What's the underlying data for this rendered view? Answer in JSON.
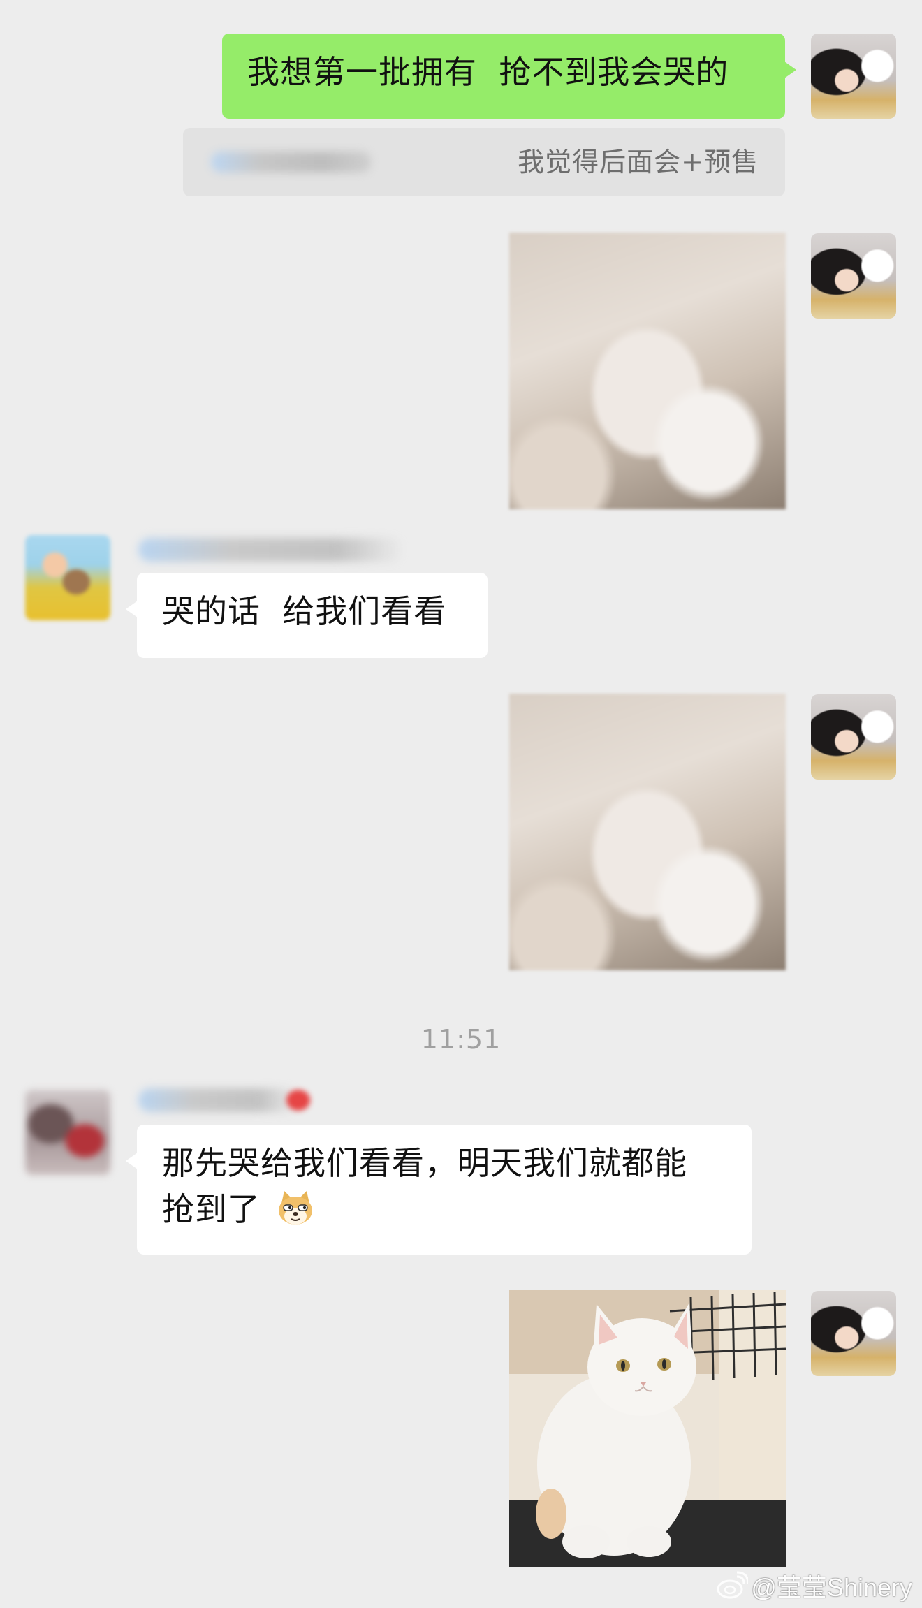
{
  "messages": {
    "m1": {
      "text": "我想第一批拥有  抢不到我会哭的",
      "quote_text": "我觉得后面会+预售"
    },
    "m3": {
      "text": "哭的话  给我们看看"
    },
    "m5": {
      "text_line1": "那先哭给我们看看，明天我们就都能",
      "text_line2": "抢到了"
    }
  },
  "timestamp": "11:51",
  "watermark": "@莹莹Shinery",
  "icons": {
    "emoji": "doge-emoji-icon",
    "watermark_logo": "weibo-icon"
  },
  "colors": {
    "background": "#ededed",
    "self_bubble": "#95ec69",
    "other_bubble": "#ffffff",
    "timestamp": "#a0a0a0"
  }
}
